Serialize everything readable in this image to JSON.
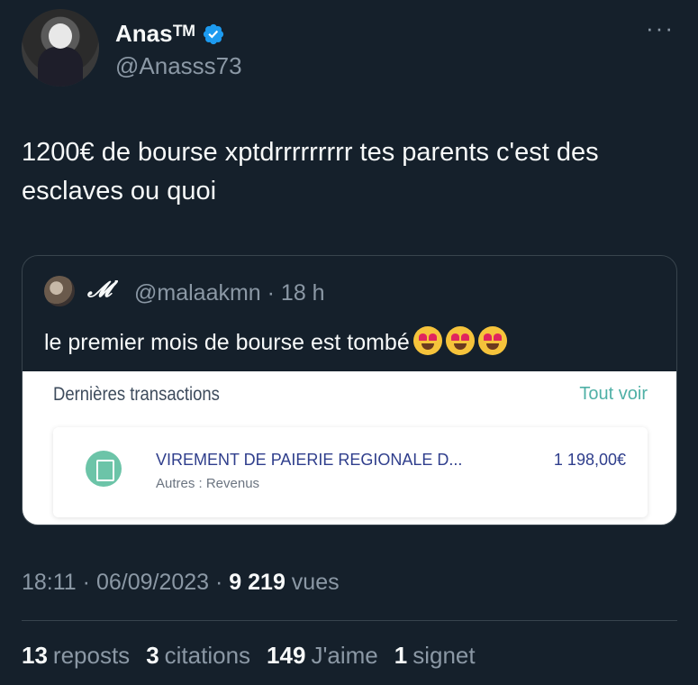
{
  "author": {
    "display_name": "Anasᵀᴹ",
    "handle": "@Anasss73",
    "verified": true
  },
  "tweet": {
    "text": "1200€ de bourse xptdrrrrrrrrr tes parents c'est des esclaves ou quoi",
    "time": "18:11",
    "date": "06/09/2023",
    "views_count": "9 219",
    "views_label": "vues"
  },
  "quoted": {
    "name": "𝓜’",
    "handle": "@malaakmn",
    "age": "18 h",
    "text": "le premier mois de bourse est tombé",
    "emojis": [
      "smiling-face-with-heart-eyes",
      "smiling-face-with-heart-eyes",
      "smiling-face-with-heart-eyes"
    ],
    "image": {
      "title": "Dernières transactions",
      "link": "Tout voir",
      "transaction": {
        "label": "VIREMENT DE  PAIERIE REGIONALE D...",
        "category": "Autres : Revenus",
        "amount": "1 198,00€"
      }
    }
  },
  "stats": [
    {
      "count": "13",
      "label": "reposts"
    },
    {
      "count": "3",
      "label": "citations"
    },
    {
      "count": "149",
      "label": "J'aime"
    },
    {
      "count": "1",
      "label": "signet"
    }
  ],
  "colors": {
    "background": "#15202b",
    "secondary_text": "#8b98a5",
    "verified_badge": "#1d9bf0",
    "bank_link": "#4fb0a6",
    "bank_text": "#2f3e8c"
  }
}
